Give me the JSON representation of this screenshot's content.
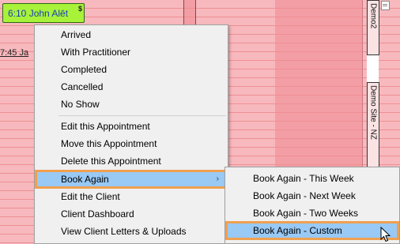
{
  "appointment": {
    "label": "6:10 John Alēt",
    "badge": "$"
  },
  "second_appointment": {
    "label": "7:45 Ja"
  },
  "sites": {
    "top": "Demo2",
    "middle": "Demo Site - NZ"
  },
  "context_menu": {
    "items": [
      {
        "label": "Arrived"
      },
      {
        "label": "With Practitioner"
      },
      {
        "label": "Completed"
      },
      {
        "label": "Cancelled"
      },
      {
        "label": "No Show"
      },
      {
        "label": "Edit this Appointment"
      },
      {
        "label": "Move this Appointment"
      },
      {
        "label": "Delete this Appointment"
      },
      {
        "label": "Book Again",
        "arrow": "›"
      },
      {
        "label": "Edit the Client"
      },
      {
        "label": "Client Dashboard"
      },
      {
        "label": "View Client Letters & Uploads"
      }
    ]
  },
  "submenu": {
    "items": [
      {
        "label": "Book Again - This Week"
      },
      {
        "label": "Book Again - Next Week"
      },
      {
        "label": "Book Again - Two Weeks"
      },
      {
        "label": "Book Again - Custom"
      }
    ]
  },
  "colors": {
    "slot_bg": "#f7b9bd",
    "slot_line": "#ee8f95",
    "appointment_bg": "#a8f23a",
    "highlight": "#99c9f5",
    "focus_outline": "#f0a050"
  }
}
